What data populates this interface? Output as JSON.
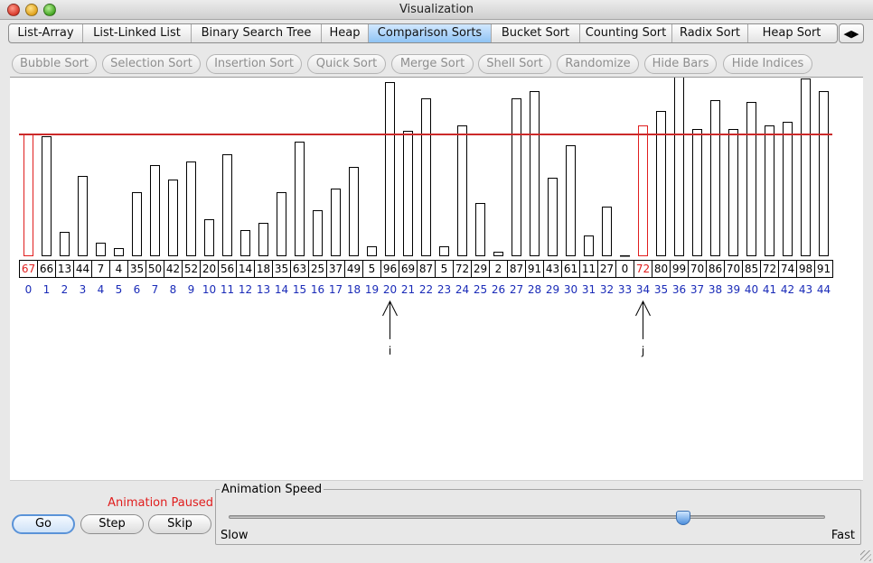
{
  "window": {
    "title": "Visualization"
  },
  "tabs": [
    {
      "label": "List-Array",
      "active": false
    },
    {
      "label": "List-Linked List",
      "active": false
    },
    {
      "label": "Binary Search Tree",
      "active": false
    },
    {
      "label": "Heap",
      "active": false
    },
    {
      "label": "Comparison Sorts",
      "active": true
    },
    {
      "label": "Bucket Sort",
      "active": false
    },
    {
      "label": "Counting Sort",
      "active": false
    },
    {
      "label": "Radix Sort",
      "active": false
    },
    {
      "label": "Heap Sort",
      "active": false
    }
  ],
  "tab_scroll": {
    "left": "◀",
    "right": "▶"
  },
  "sort_buttons": [
    "Bubble Sort",
    "Selection Sort",
    "Insertion Sort",
    "Quick Sort",
    "Merge Sort",
    "Shell Sort",
    "Randomize",
    "Hide Bars",
    "Hide Indices"
  ],
  "array": {
    "values": [
      67,
      66,
      13,
      44,
      7,
      4,
      35,
      50,
      42,
      52,
      20,
      56,
      14,
      18,
      35,
      63,
      25,
      37,
      49,
      5,
      96,
      69,
      87,
      5,
      72,
      29,
      2,
      87,
      91,
      43,
      61,
      11,
      27,
      0,
      72,
      80,
      99,
      70,
      86,
      70,
      85,
      72,
      74,
      98,
      91
    ],
    "highlighted": [
      0,
      34
    ],
    "pivot_value": 67,
    "pointers": [
      {
        "label": "i",
        "index": 20
      },
      {
        "label": "j",
        "index": 34
      }
    ]
  },
  "colors": {
    "highlight": "#e01e1e",
    "index_text": "#1a2bb8",
    "pivot_line": "#cc2a2a"
  },
  "controls": {
    "status": "Animation Paused",
    "go": "Go",
    "step": "Step",
    "skip": "Skip"
  },
  "speed": {
    "legend": "Animation Speed",
    "min_label": "Slow",
    "max_label": "Fast",
    "value_fraction": 0.76
  }
}
